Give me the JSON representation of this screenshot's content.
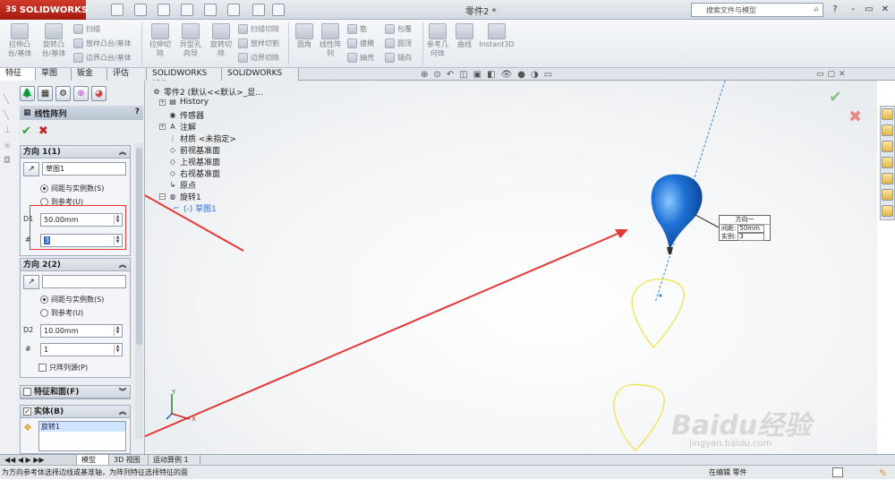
{
  "app": {
    "brand": "SOLIDWORKS",
    "brand_prefix": "3S",
    "doc_title": "零件2 *"
  },
  "search": {
    "placeholder": "搜索文件与模型"
  },
  "window_controls": [
    "?",
    "-",
    "▭",
    "✕"
  ],
  "ribbon": {
    "big": [
      {
        "label1": "拉伸凸",
        "label2": "台/基体"
      },
      {
        "label1": "旋转凸",
        "label2": "台/基体"
      },
      {
        "label1": "拉伸切",
        "label2": "除"
      },
      {
        "label1": "异型孔",
        "label2": "向导"
      },
      {
        "label1": "旋转切",
        "label2": "除"
      },
      {
        "label1": "圆角",
        "label2": ""
      },
      {
        "label1": "线性阵",
        "label2": "列"
      },
      {
        "label1": "参考几",
        "label2": "何体"
      },
      {
        "label1": "曲线",
        "label2": ""
      },
      {
        "label1": "Instant3D",
        "label2": ""
      }
    ],
    "small": [
      "扫描",
      "放样凸台/基体",
      "边界凸台/基体",
      "扫描切除",
      "放样切割",
      "边界切除",
      "筋",
      "拔模",
      "抽壳",
      "包覆",
      "圆顶",
      "镜向"
    ]
  },
  "tabs": [
    "特征",
    "草图",
    "钣金",
    "评估",
    "SOLIDWORKS 插件",
    "SOLIDWORKS MBD"
  ],
  "property_manager": {
    "title": "线性阵列",
    "help": "?",
    "ok": "✔",
    "cancel": "✖",
    "direction1": {
      "title": "方向 1(1)",
      "ref": "草图1",
      "opt_spacing": "间距与实例数(S)",
      "opt_upto": "到参考(U)",
      "spacing": "50.00mm",
      "count": "3",
      "spacing_icon": "D1"
    },
    "direction2": {
      "title": "方向 2(2)",
      "ref": "",
      "opt_spacing": "间距与实例数(S)",
      "opt_upto": "到参考(U)",
      "spacing": "10.00mm",
      "count": "1",
      "spacing_icon": "D2",
      "seed_only": "只阵列源(P)"
    },
    "features_faces": {
      "title": "特征和面(F)"
    },
    "bodies": {
      "title": "实体(B)",
      "item": "旋转1"
    }
  },
  "tree": {
    "root": "零件2 (默认<<默认>_显...",
    "items": [
      "History",
      "传感器",
      "注解",
      "材质 <未指定>",
      "前视基准面",
      "上视基准面",
      "右视基准面",
      "原点",
      "旋转1",
      "(-) 草图1"
    ]
  },
  "callout": {
    "title": "方向一",
    "spacing_label": "间距:",
    "spacing_value": "50mm",
    "count_label": "实例:",
    "count_value": "3"
  },
  "triad": {
    "x": "X",
    "y": "Y"
  },
  "bottom_tabs": [
    "模型",
    "3D 视图",
    "运动算例 1"
  ],
  "status": {
    "message": "为方向参考体选择边线或基准轴，为阵列特征选择特征的面",
    "mode": "在编辑 零件"
  },
  "watermark": {
    "text": "Baidu经验",
    "url": "jingyan.baidu.com"
  },
  "colors": {
    "accent_red": "#d23a2b",
    "balloon": "#1f73d6",
    "sketch_yellow": "#f0e45a",
    "axis_blue": "#3b82d6"
  }
}
